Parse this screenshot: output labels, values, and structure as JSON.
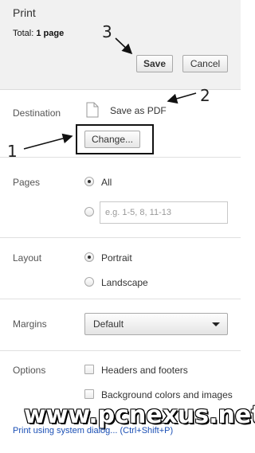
{
  "header": {
    "title": "Print",
    "total_label": "Total:",
    "total_value": "1 page",
    "save_label": "Save",
    "cancel_label": "Cancel"
  },
  "destination": {
    "label": "Destination",
    "name": "Save as PDF",
    "change_label": "Change..."
  },
  "pages": {
    "label": "Pages",
    "option_all": "All",
    "option_all_selected": true,
    "range_placeholder": "e.g. 1-5, 8, 11-13"
  },
  "layout": {
    "label": "Layout",
    "portrait": "Portrait",
    "landscape": "Landscape",
    "selected": "Portrait"
  },
  "margins": {
    "label": "Margins",
    "value": "Default"
  },
  "options": {
    "label": "Options",
    "headers_footers": "Headers and footers",
    "background": "Background colors and images"
  },
  "system_dialog_link": "Print using system dialog... (Ctrl+Shift+P)",
  "annotations": {
    "one": "1",
    "two": "2",
    "three": "3"
  },
  "watermark": "www.pcnexus.net",
  "colors": {
    "header_bg": "#f1f1f1",
    "link": "#1a4fb5"
  }
}
